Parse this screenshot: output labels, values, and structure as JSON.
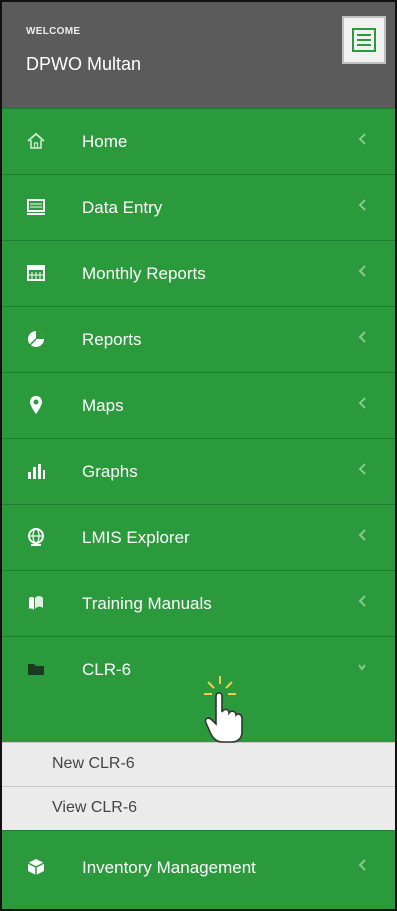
{
  "header": {
    "welcome_label": "WELCOME",
    "user_name": "DPWO Multan"
  },
  "menu": [
    {
      "label": "Home",
      "icon": "home-icon"
    },
    {
      "label": "Data Entry",
      "icon": "monitor-icon"
    },
    {
      "label": "Monthly Reports",
      "icon": "calendar-icon"
    },
    {
      "label": "Reports",
      "icon": "pie-chart-icon"
    },
    {
      "label": "Maps",
      "icon": "map-marker-icon"
    },
    {
      "label": "Graphs",
      "icon": "bar-chart-icon"
    },
    {
      "label": "LMIS Explorer",
      "icon": "globe-icon"
    },
    {
      "label": "Training Manuals",
      "icon": "book-icon"
    },
    {
      "label": "CLR-6",
      "icon": "folder-icon"
    }
  ],
  "submenu": [
    {
      "label": "New CLR-6"
    },
    {
      "label": "View CLR-6"
    }
  ],
  "footer_item": {
    "label": "Inventory Management",
    "icon": "cube-icon"
  },
  "colors": {
    "header_bg": "#5b5b5b",
    "menu_bg": "#2a9a3c",
    "submenu_bg": "#ebebeb"
  }
}
